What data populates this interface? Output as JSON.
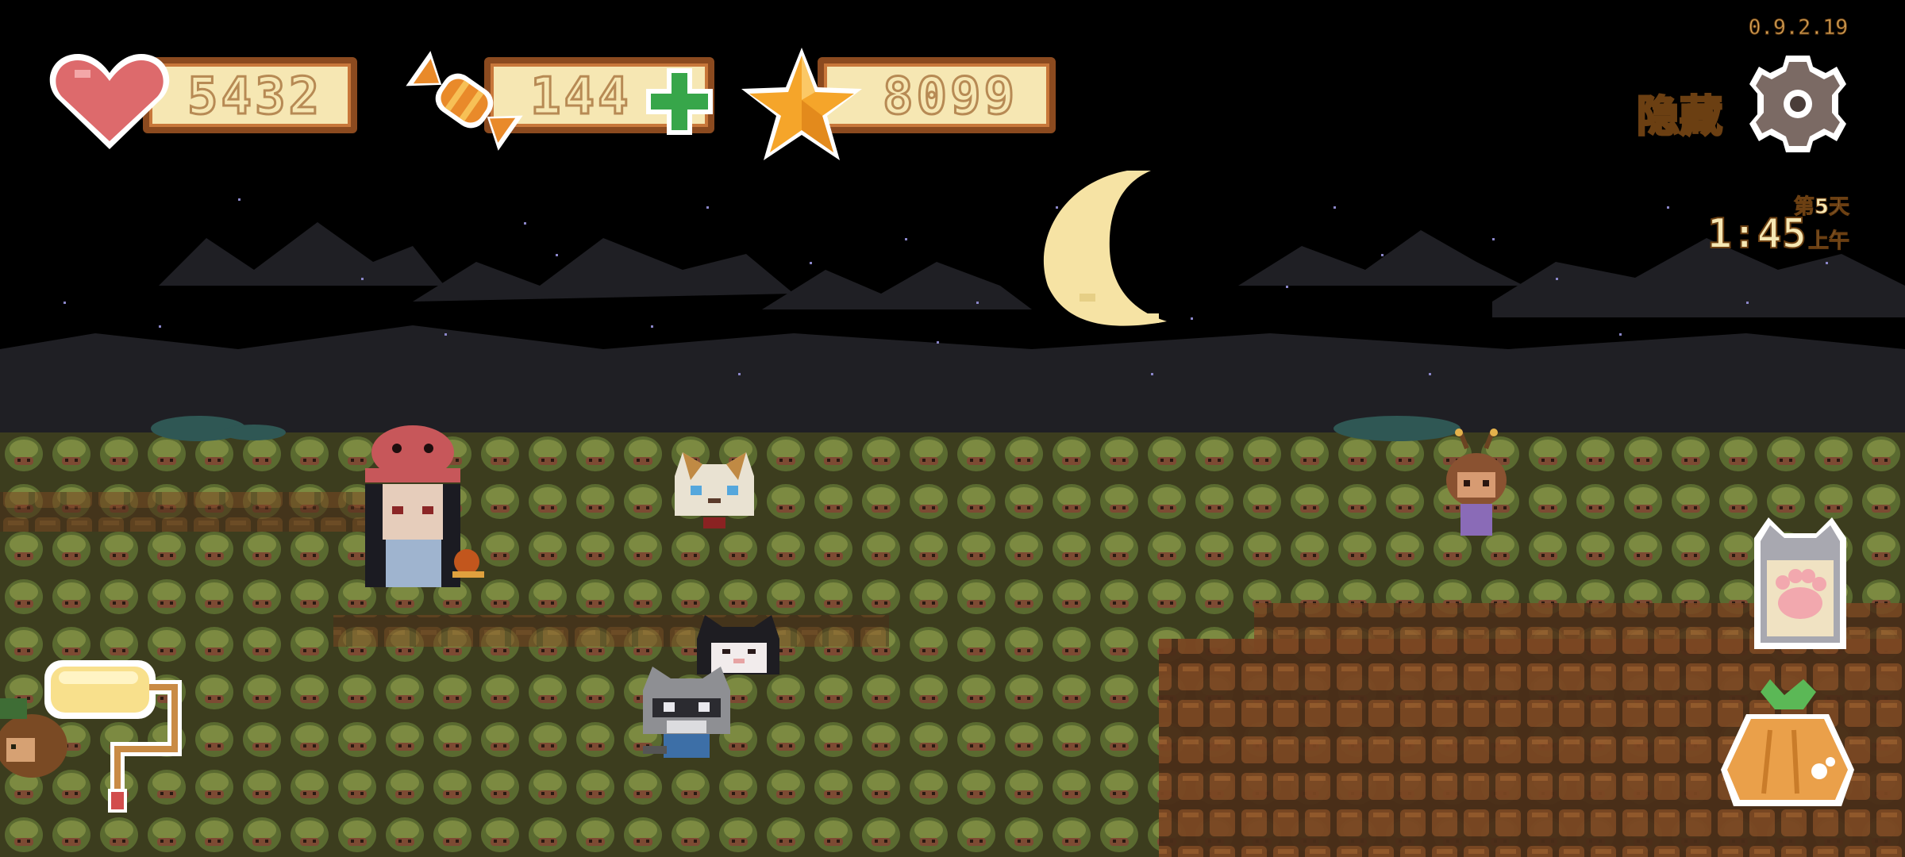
{
  "hud": {
    "hearts": "5432",
    "candies": "144",
    "stars": "8099",
    "version": "0.9.2.19",
    "hide_label": "隐藏"
  },
  "clock": {
    "day": "第5天",
    "time": "1:45",
    "ampm": "上午"
  },
  "colors": {
    "sky": "#000000",
    "field_green": "#4e5a2e",
    "field_dark": "#2b3018",
    "soil": "#6b3f1d",
    "moon": "#f6e3a4",
    "hud_border": "#8b4a1f",
    "hud_fill": "#f6e7b3",
    "plus_green": "#37a64a"
  },
  "icons": {
    "heart": "heart-icon",
    "candy": "candy-icon",
    "star": "star-icon",
    "settings": "gear-icon",
    "add": "plus-icon",
    "paint_roller": "paint-roller-icon",
    "cat_card": "cat-paw-card-icon",
    "seed_bag": "turnip-bag-icon"
  }
}
